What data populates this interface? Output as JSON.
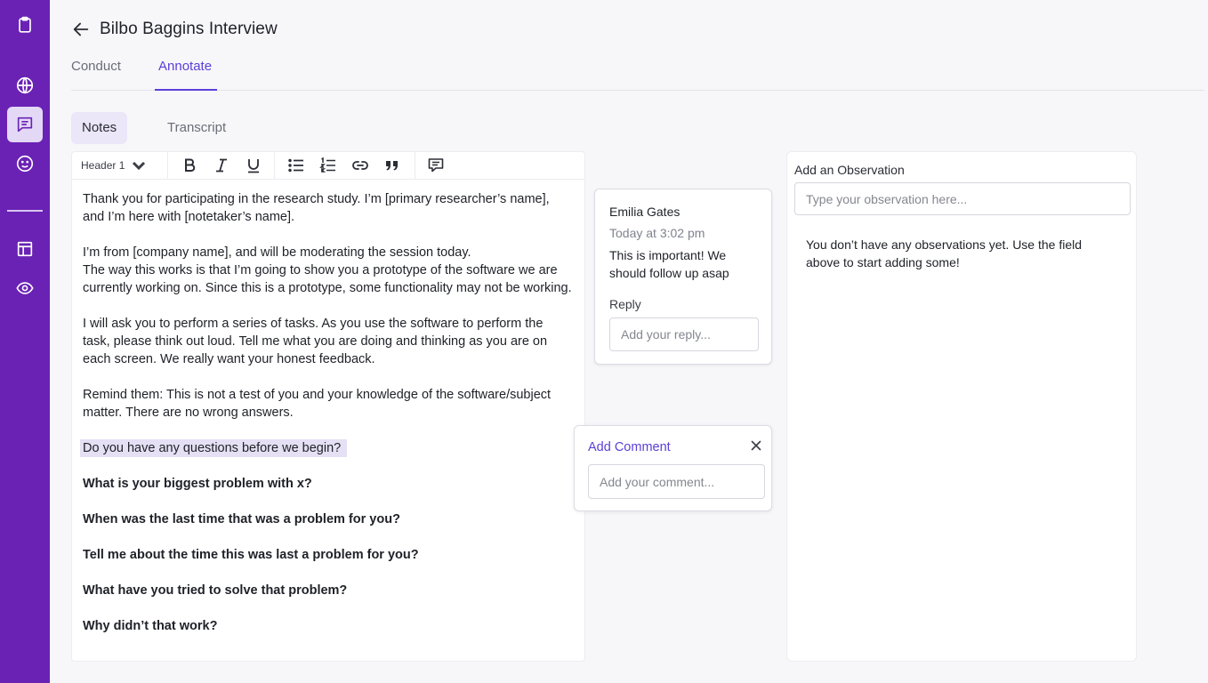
{
  "sidebar": {
    "items": [
      {
        "icon": "clipboard-icon"
      },
      {
        "icon": "globe-icon"
      },
      {
        "icon": "chat-icon",
        "active": true
      },
      {
        "icon": "smiley-icon"
      },
      {
        "icon": "layout-icon"
      },
      {
        "icon": "eye-icon"
      }
    ],
    "colors": {
      "background": "#6a22b5",
      "active": "#e3d9f7"
    }
  },
  "header": {
    "title": "Bilbo Baggins Interview"
  },
  "tabs": [
    {
      "label": "Conduct",
      "active": false
    },
    {
      "label": "Annotate",
      "active": true
    }
  ],
  "subtabs": [
    {
      "label": "Notes",
      "active": true
    },
    {
      "label": "Transcript",
      "active": false
    }
  ],
  "toolbar": {
    "header_select": "Header 1",
    "buttons": [
      "bold-icon",
      "italic-icon",
      "underline-icon",
      "bullet-list-icon",
      "numbered-list-icon",
      "link-icon",
      "quote-icon",
      "comment-icon"
    ]
  },
  "editor": {
    "p1": "Thank you for participating in the research study. I’m [primary researcher’s name], and I’m here with [notetaker’s name].",
    "p2": "I’m from [company name], and will be moderating the session today.",
    "p3": "The way this works is that I’m going to show you a prototype of the software we are currently working on. Since this is a prototype, some functionality may not be working.",
    "p4": "I will ask you to perform a series of tasks. As you use the software to perform the task, please think out loud. Tell me what you are doing and thinking as you are on each screen. We really want your honest feedback.",
    "p5": "Remind them: This is not a test of you and your knowledge of the software/subject matter. There are no wrong answers.",
    "highlighted": "Do you have any questions before we begin?",
    "q1": "What is your biggest problem with x?",
    "q2": "When was the last time that was a problem for you?",
    "q3": "Tell me about the time this was last a problem for you?",
    "q4": "What have you tried to solve that problem?",
    "q5": "Why didn’t that work?"
  },
  "comment": {
    "author": "Emilia Gates",
    "time": "Today at 3:02 pm",
    "text": "This is important! We should follow up asap",
    "reply_label": "Reply",
    "reply_placeholder": "Add your reply..."
  },
  "add_comment": {
    "title": "Add Comment",
    "placeholder": "Add your comment..."
  },
  "observations": {
    "label": "Add an Observation",
    "placeholder": "Type your observation here...",
    "empty_text": "You don’t have any observations yet. Use the field above to start adding some!"
  },
  "colors": {
    "accent": "#5b3fd6",
    "highlight": "#e5e0f4"
  }
}
